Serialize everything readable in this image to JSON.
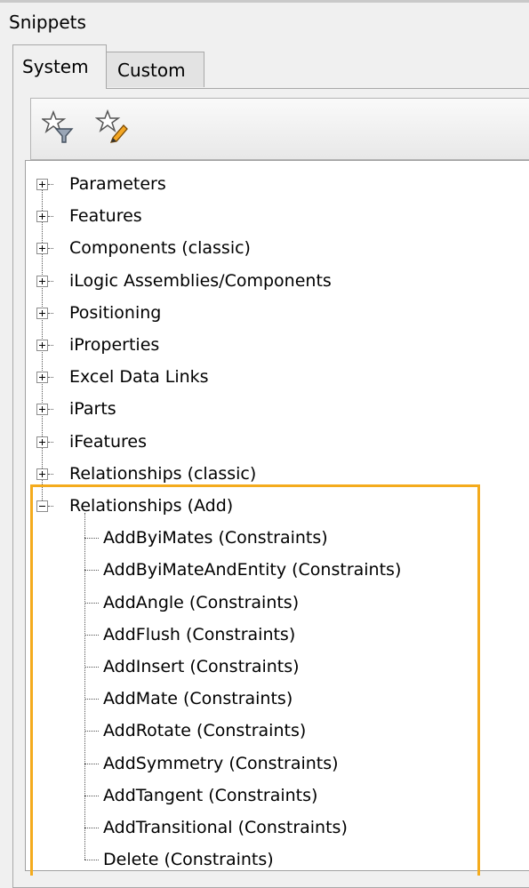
{
  "window": {
    "title": "Snippets"
  },
  "tabs": [
    {
      "label": "System",
      "active": true
    },
    {
      "label": "Custom",
      "active": false
    }
  ],
  "toolbar": {
    "buttons": [
      {
        "icon": "star-filter-icon"
      },
      {
        "icon": "star-edit-icon"
      }
    ]
  },
  "tree": {
    "top_nodes": [
      {
        "label": "Parameters",
        "expanded": false
      },
      {
        "label": "Features",
        "expanded": false
      },
      {
        "label": "Components (classic)",
        "expanded": false
      },
      {
        "label": "iLogic Assemblies/Components",
        "expanded": false
      },
      {
        "label": "Positioning",
        "expanded": false
      },
      {
        "label": "iProperties",
        "expanded": false
      },
      {
        "label": "Excel Data Links",
        "expanded": false
      },
      {
        "label": "iParts",
        "expanded": false
      },
      {
        "label": "iFeatures",
        "expanded": false
      },
      {
        "label": "Relationships (classic)",
        "expanded": false
      },
      {
        "label": "Relationships (Add)",
        "expanded": true
      }
    ],
    "children": [
      "AddByiMates (Constraints)",
      "AddByiMateAndEntity (Constraints)",
      "AddAngle (Constraints)",
      "AddFlush (Constraints)",
      "AddInsert (Constraints)",
      "AddMate (Constraints)",
      "AddRotate (Constraints)",
      "AddSymmetry (Constraints)",
      "AddTangent (Constraints)",
      "AddTransitional (Constraints)",
      "Delete (Constraints)"
    ]
  },
  "colors": {
    "highlight": "#f4ab1d",
    "tree_bg": "#ffffff",
    "chrome_bg": "#f0f0f0"
  }
}
